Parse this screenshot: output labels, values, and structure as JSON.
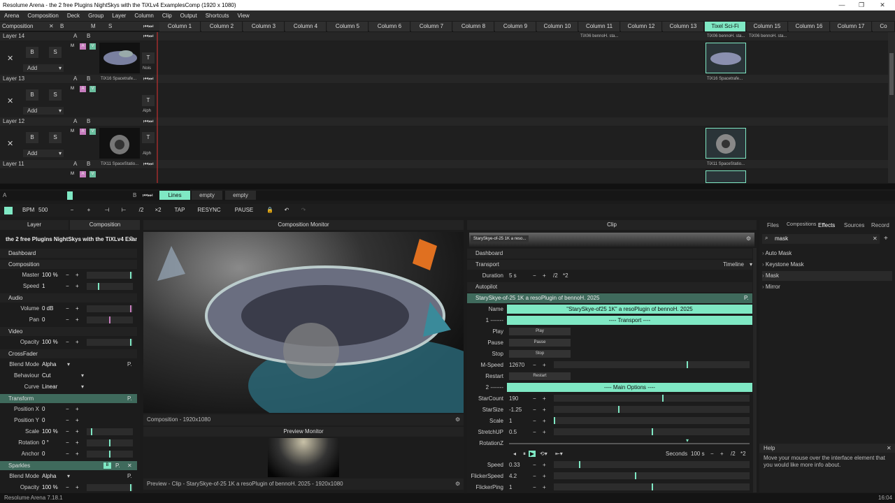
{
  "window": {
    "title": "Resolume Arena - the 2 free Plugins NightSkys with the TiXLv4 ExamplesComp  (1920 x 1080)"
  },
  "menu": [
    "Arena",
    "Composition",
    "Deck",
    "Group",
    "Layer",
    "Column",
    "Clip",
    "Output",
    "Shortcuts",
    "View"
  ],
  "header": {
    "composition_label": "Composition",
    "b": "B",
    "m": "M",
    "s": "S",
    "columns": [
      "Column 1",
      "Column 2",
      "Column 3",
      "Column 4",
      "Column 5",
      "Column 6",
      "Column 7",
      "Column 8",
      "Column 9",
      "Column 10",
      "Column 11",
      "Column 12",
      "Column 13",
      "Tixel Sci-Fi",
      "Column 15",
      "Column 16",
      "Column 17",
      "Co"
    ]
  },
  "layers": [
    {
      "name": "Layer 14",
      "clip_label": "TiX06 bennoH. sta...",
      "clip_label2": "TiX06 bennoH. sta...",
      "clip_label3": "TiX06 bennoH. sta...",
      "clip_label4": "TiX16 Spacetrafe...",
      "side": "Nois"
    },
    {
      "name": "Layer 13",
      "clip_label": "TiX16 Spacetrafe...",
      "side": "Alph"
    },
    {
      "name": "Layer 12",
      "clip_label": "TiX11 SpaceStatio...",
      "side": "Alph",
      "clip_label4": "TiX11 SpaceStatio..."
    },
    {
      "name": "Layer 11"
    }
  ],
  "layer_ctrl": {
    "x": "✕",
    "b": "B",
    "s": "S",
    "add": "Add",
    "a": "A",
    "t": "T",
    "mm": "M",
    "aa": "A",
    "v": "V"
  },
  "deck": {
    "a": "A",
    "b": "B",
    "tabs": [
      "Lines",
      "empty",
      "empty"
    ]
  },
  "bpm": {
    "label": "BPM",
    "value": "500",
    "minus": "−",
    "plus": "+",
    "div": "/2",
    "mul": "×2",
    "tap": "TAP",
    "resync": "RESYNC",
    "pause": "PAUSE"
  },
  "left_panel": {
    "tab_layer": "Layer",
    "tab_comp": "Composition",
    "comp_name": "the 2 free Plugins NightSkys with the TiXLv4 ExamplesComp...",
    "sections": {
      "dashboard": "Dashboard",
      "composition": "Composition",
      "audio": "Audio",
      "video": "Video",
      "crossfader": "CrossFader",
      "transform": "Transform",
      "sparkles": "Sparkles"
    },
    "props": {
      "master": {
        "label": "Master",
        "value": "100 %"
      },
      "speed": {
        "label": "Speed",
        "value": "1"
      },
      "volume": {
        "label": "Volume",
        "value": "0 dB"
      },
      "pan": {
        "label": "Pan",
        "value": "0"
      },
      "opacity": {
        "label": "Opacity",
        "value": "100 %"
      },
      "blend": {
        "label": "Blend Mode",
        "value": "Alpha"
      },
      "behaviour": {
        "label": "Behaviour",
        "value": "Cut"
      },
      "curve": {
        "label": "Curve",
        "value": "Linear"
      },
      "posx": {
        "label": "Position X",
        "value": "0"
      },
      "posy": {
        "label": "Position Y",
        "value": "0"
      },
      "scale": {
        "label": "Scale",
        "value": "100 %"
      },
      "rotation": {
        "label": "Rotation",
        "value": "0 °"
      },
      "anchor": {
        "label": "Anchor",
        "value": "0"
      },
      "blend2": {
        "label": "Blend Mode",
        "value": "Alpha"
      },
      "opacity2": {
        "label": "Opacity",
        "value": "100 %"
      }
    },
    "p": "P.",
    "b": "B",
    "x": "✕"
  },
  "monitor": {
    "title": "Composition Monitor",
    "info": "Composition - 1920x1080",
    "preview_title": "Preview Monitor",
    "preview_info": "Preview - Clip - StarySkye-of-25 1K   a resoPlugin of bennoH. 2025 - 1920x1080"
  },
  "clip_panel": {
    "title": "Clip",
    "clip_name_short": "StarySkye-of-25 1K   a reso...",
    "dashboard": "Dashboard",
    "transport": "Transport",
    "timeline": "Timeline",
    "duration_label": "Duration",
    "duration_value": "5 s",
    "div": "/2",
    "mul": "*2",
    "autopilot": "Autopilot",
    "plugin": "StarySkye-of-25 1K   a resoPlugin of bennoH. 2025",
    "name_label": "Name",
    "name_value": "\"StarySkye-of25 1K\"  a resoPlugin of bennoH. 2025",
    "sep1_label": "1 -------",
    "sep1_value": "---- Transport ----",
    "play_label": "Play",
    "play_btn": "Play",
    "pause_label": "Pause",
    "pause_btn": "Pause",
    "stop_label": "Stop",
    "stop_btn": "Stop",
    "mspeed_label": "M-Speed",
    "mspeed_value": "12670",
    "restart_label": "Restart",
    "restart_btn": "Restart",
    "sep2_label": "2 -------",
    "sep2_value": "---- Main Options ----",
    "starcount_label": "StarCount",
    "starcount_value": "190",
    "starsize_label": "StarSize",
    "starsize_value": "-1.25",
    "scale_label": "Scale",
    "scale_value": "1",
    "stretch_label": "StretchUP",
    "stretch_value": "0.5",
    "rotz_label": "RotationZ",
    "seconds_label": "Seconds",
    "seconds_value": "100 s",
    "speed_label": "Speed",
    "speed_value": "0.33",
    "flickerspeed_label": "FlickerSpeed",
    "flickerspeed_value": "4.2",
    "flickerping_label": "FlickerPing",
    "flickerping_value": "1",
    "pm_minus": "−",
    "pm_plus": "+"
  },
  "fx_panel": {
    "tabs": [
      "Files",
      "Compositions",
      "Effects",
      "Sources",
      "Record"
    ],
    "search": "mask",
    "items": [
      "Auto Mask",
      "Keystone Mask",
      "Mask",
      "Mirror"
    ],
    "help_title": "Help",
    "help_text": "Move your mouse over the interface element that you would like more info about."
  },
  "status": {
    "left": "Resolume Arena 7.18.1",
    "right": "16:04"
  }
}
